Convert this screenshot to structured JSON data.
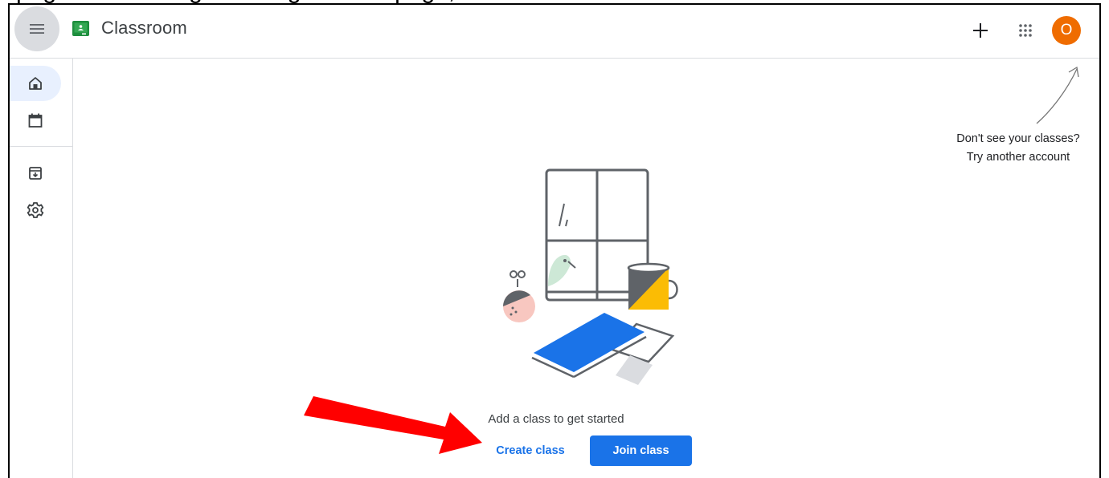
{
  "app": {
    "title": "Classroom",
    "avatar_letter": "O"
  },
  "colors": {
    "accent": "#1a73e8",
    "avatar": "#ef6c00",
    "active_nav_bg": "#e8f0fe"
  },
  "topbar": {
    "menu_icon": "hamburger-menu-icon",
    "actions": [
      {
        "icon": "plus-icon",
        "label": "Create or join a class"
      },
      {
        "icon": "apps-grid-icon",
        "label": "Google apps"
      },
      {
        "icon": "avatar",
        "label": "Account"
      }
    ]
  },
  "sidebar": {
    "items": [
      {
        "icon": "home-icon",
        "active": true
      },
      {
        "icon": "calendar-icon",
        "active": false
      },
      {
        "icon": "archive-icon",
        "active": false
      },
      {
        "icon": "gear-icon",
        "active": false
      }
    ]
  },
  "hint": {
    "line1": "Don't see your classes?",
    "line2": "Try another account"
  },
  "empty_state": {
    "message": "Add a class to get started",
    "create_label": "Create class",
    "join_label": "Join class"
  }
}
